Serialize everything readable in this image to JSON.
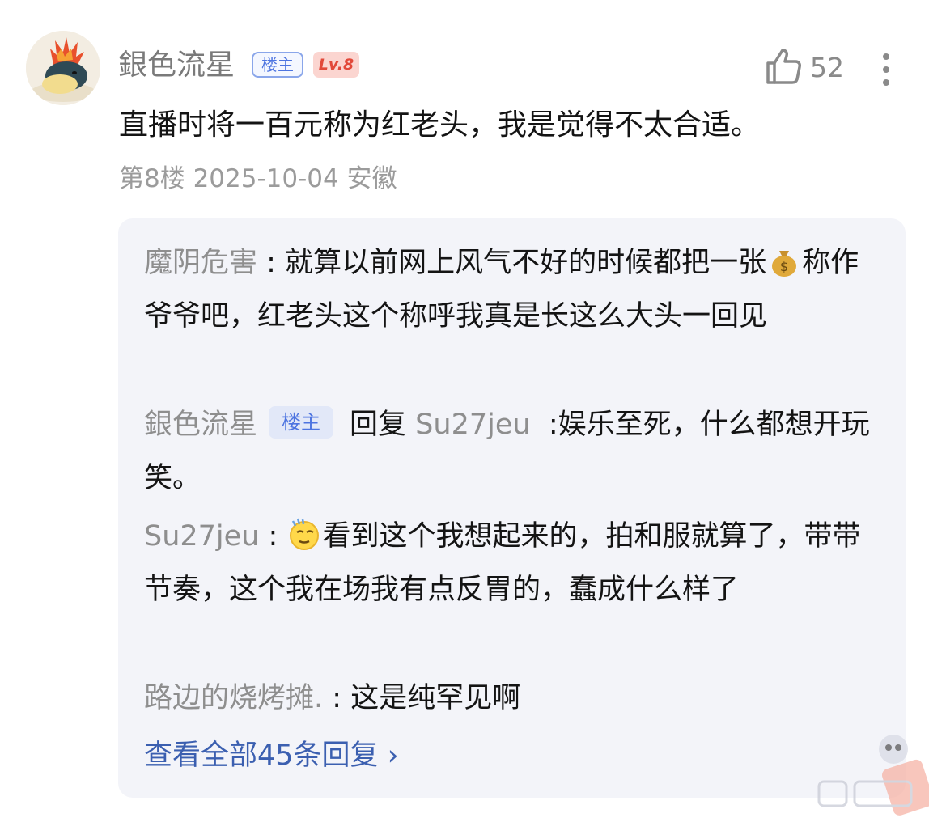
{
  "comment": {
    "author": "銀色流星",
    "op_badge": "楼主",
    "level_badge": "Lv.8",
    "likes": "52",
    "text": "直播时将一百元称为红老头，我是觉得不太合适。",
    "meta": "第8楼 2025-10-04 安徽"
  },
  "replies": [
    {
      "name": "魔阴危害",
      "sep": " : ",
      "text": "就算以前网上风气不好的时候都把一张💰称作爷爷吧，红老头这个称呼我真是长这么大头一回见"
    },
    {
      "name": "銀色流星",
      "badge": "楼主",
      "reply_word": "回复",
      "reply_to": "Su27jeu",
      "text": ":娱乐至死，什么都想开玩笑。"
    },
    {
      "name": "Su27jeu",
      "sep": " : ",
      "text": "看到这个我想起来的，拍和服就算了，带带节奏，这个我在场我有点反胃的，蠢成什么样了"
    },
    {
      "name": "路边的烧烤摊.",
      "sep": " : ",
      "text": "这是纯罕见啊"
    }
  ],
  "view_all": "查看全部45条回复 ›",
  "icons": {
    "like": "thumbs-up-icon",
    "more": "more-vertical-icon",
    "money": "money-bag-icon",
    "thinking": "thinking-emoji-icon"
  },
  "colors": {
    "accent": "#3b5fb0",
    "op_badge": "#4d74e0",
    "level_badge_bg": "#fbd5d0",
    "reply_bg": "#f3f4f9"
  }
}
